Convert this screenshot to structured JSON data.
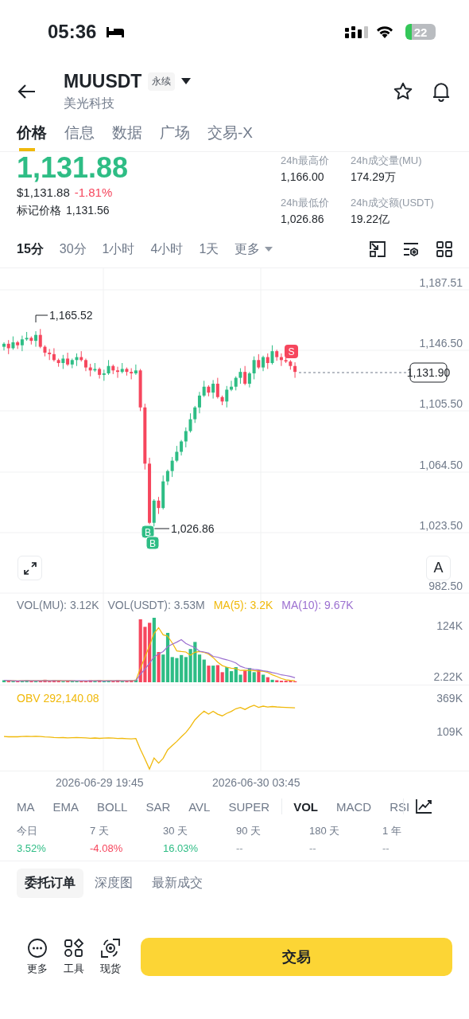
{
  "status_bar": {
    "time": "05:36",
    "battery": "22"
  },
  "header": {
    "symbol": "MUUSDT",
    "badge": "永续",
    "subtitle": "美光科技"
  },
  "tabs": [
    {
      "label": "价格",
      "selected": true
    },
    {
      "label": "信息",
      "selected": false
    },
    {
      "label": "数据",
      "selected": false
    },
    {
      "label": "广场",
      "selected": false
    },
    {
      "label": "交易-X",
      "selected": false
    }
  ],
  "price": {
    "last": "1,131.88",
    "usd": "$1,131.88",
    "change": "-1.81%",
    "mark_label": "标记价格",
    "mark_value": "1,131.56"
  },
  "stats": [
    {
      "label": "24h最高价",
      "value": "1,166.00"
    },
    {
      "label": "24h成交量(MU)",
      "value": "174.29万"
    },
    {
      "label": "24h最低价",
      "value": "1,026.86"
    },
    {
      "label": "24h成交额(USDT)",
      "value": "19.22亿"
    }
  ],
  "intervals": [
    {
      "label": "15分",
      "selected": true
    },
    {
      "label": "30分",
      "selected": false
    },
    {
      "label": "1小时",
      "selected": false
    },
    {
      "label": "4小时",
      "selected": false
    },
    {
      "label": "1天",
      "selected": false
    }
  ],
  "more_interval": "更多",
  "chart": {
    "y_axis": [
      "1,187.51",
      "1,146.50",
      "1,105.50",
      "1,064.50",
      "1,023.50",
      "982.50"
    ],
    "current_price": "1,131.90",
    "high_label": "1,165.52",
    "low_label": "1,026.86",
    "sell_marker": "S",
    "buy_markers": [
      "B",
      "B"
    ],
    "scale_button": "A"
  },
  "volume": {
    "legend": [
      {
        "text": "VOL(MU): 3.12K",
        "color": "#707a8a"
      },
      {
        "text": "VOL(USDT): 3.53M",
        "color": "#707a8a"
      },
      {
        "text": "MA(5): 3.2K",
        "color": "#f0b90b"
      },
      {
        "text": "MA(10): 9.67K",
        "color": "#9b6fd0"
      }
    ],
    "y_axis": [
      "124K",
      "2.22K"
    ]
  },
  "obv": {
    "label": "OBV 292,140.08",
    "y_axis": [
      "369K",
      "109K"
    ]
  },
  "time_axis": [
    "2026-06-29 19:45",
    "2026-06-30 03:45"
  ],
  "indicators": [
    {
      "label": "MA",
      "selected": false,
      "divider_before": false
    },
    {
      "label": "EMA",
      "selected": false,
      "divider_before": false
    },
    {
      "label": "BOLL",
      "selected": false,
      "divider_before": false
    },
    {
      "label": "SAR",
      "selected": false,
      "divider_before": false
    },
    {
      "label": "AVL",
      "selected": false,
      "divider_before": false
    },
    {
      "label": "SUPER",
      "selected": false,
      "divider_before": false
    },
    {
      "label": "VOL",
      "selected": true,
      "divider_before": true
    },
    {
      "label": "MACD",
      "selected": false,
      "divider_before": false
    },
    {
      "label": "RSI",
      "selected": false,
      "divider_before": false
    }
  ],
  "performance": [
    {
      "period": "今日",
      "value": "3.52%",
      "color": "#2ebd85"
    },
    {
      "period": "7 天",
      "value": "-4.08%",
      "color": "#f6465d"
    },
    {
      "period": "30 天",
      "value": "16.03%",
      "color": "#2ebd85"
    },
    {
      "period": "90 天",
      "value": "--",
      "color": "#929aa5"
    },
    {
      "period": "180 天",
      "value": "--",
      "color": "#929aa5"
    },
    {
      "period": "1 年",
      "value": "--",
      "color": "#929aa5"
    }
  ],
  "order_tabs": [
    {
      "label": "委托订单",
      "selected": true
    },
    {
      "label": "深度图",
      "selected": false
    },
    {
      "label": "最新成交",
      "selected": false
    }
  ],
  "bottom_bar": {
    "actions": [
      {
        "label": "更多",
        "kind": "more"
      },
      {
        "label": "工具",
        "kind": "tools"
      },
      {
        "label": "现货",
        "kind": "spot"
      }
    ],
    "trade_button": "交易"
  }
}
